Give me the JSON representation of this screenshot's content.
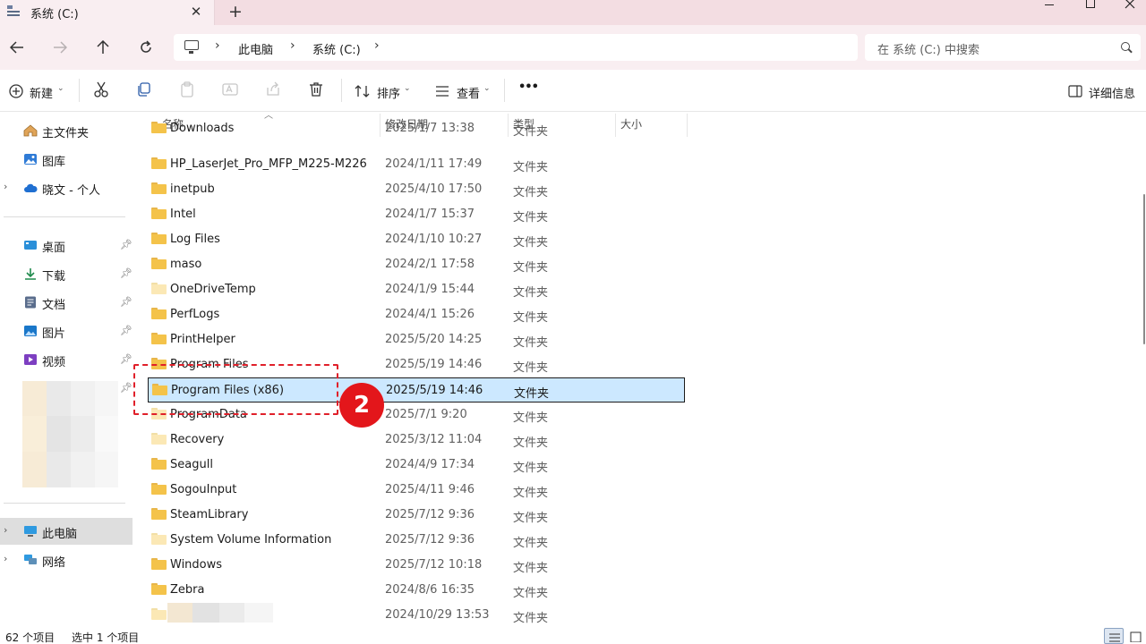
{
  "window": {
    "tab_title": "系统 (C:)",
    "tab_close_glyph": "✕",
    "new_tab_glyph": "+"
  },
  "nav": {
    "breadcrumb": [
      "此电脑",
      "系统 (C:)"
    ],
    "search_placeholder": "在 系统 (C:) 中搜索"
  },
  "toolbar": {
    "new_label": "新建",
    "sort_label": "排序",
    "view_label": "查看",
    "more_label": "•••",
    "details_label": "详细信息"
  },
  "sidebar": {
    "home": "主文件夹",
    "gallery": "图库",
    "onedrive": "晓文 - 个人",
    "desktop": "桌面",
    "downloads": "下载",
    "documents": "文档",
    "pictures": "图片",
    "videos": "视频",
    "this_pc": "此电脑",
    "network": "网络"
  },
  "columns": {
    "name": "名称",
    "modified": "修改日期",
    "type": "类型",
    "size": "大小"
  },
  "files": [
    {
      "name": "Downloads",
      "date": "2025/1/7 13:38",
      "type": "文件夹",
      "light": false
    },
    {
      "name": "HP_LaserJet_Pro_MFP_M225-M226",
      "date": "2024/1/11 17:49",
      "type": "文件夹",
      "light": false
    },
    {
      "name": "inetpub",
      "date": "2025/4/10 17:50",
      "type": "文件夹",
      "light": false
    },
    {
      "name": "Intel",
      "date": "2024/1/7 15:37",
      "type": "文件夹",
      "light": false
    },
    {
      "name": "Log Files",
      "date": "2024/1/10 10:27",
      "type": "文件夹",
      "light": false
    },
    {
      "name": "maso",
      "date": "2024/2/1 17:58",
      "type": "文件夹",
      "light": false
    },
    {
      "name": "OneDriveTemp",
      "date": "2024/1/9 15:44",
      "type": "文件夹",
      "light": true
    },
    {
      "name": "PerfLogs",
      "date": "2024/4/1 15:26",
      "type": "文件夹",
      "light": false
    },
    {
      "name": "PrintHelper",
      "date": "2025/5/20 14:25",
      "type": "文件夹",
      "light": false
    },
    {
      "name": "Program Files",
      "date": "2025/5/19 14:46",
      "type": "文件夹",
      "light": false
    },
    {
      "name": "Program Files (x86)",
      "date": "2025/5/19 14:46",
      "type": "文件夹",
      "light": false,
      "selected": true
    },
    {
      "name": "ProgramData",
      "date": "2025/7/1 9:20",
      "type": "文件夹",
      "light": true
    },
    {
      "name": "Recovery",
      "date": "2025/3/12 11:04",
      "type": "文件夹",
      "light": true
    },
    {
      "name": "Seagull",
      "date": "2024/4/9 17:34",
      "type": "文件夹",
      "light": false
    },
    {
      "name": "SogouInput",
      "date": "2025/4/11 9:46",
      "type": "文件夹",
      "light": false
    },
    {
      "name": "SteamLibrary",
      "date": "2025/7/12 9:36",
      "type": "文件夹",
      "light": false
    },
    {
      "name": "System Volume Information",
      "date": "2025/7/12 9:36",
      "type": "文件夹",
      "light": true
    },
    {
      "name": "Windows",
      "date": "2025/7/12 10:18",
      "type": "文件夹",
      "light": false
    },
    {
      "name": "Zebra",
      "date": "2024/8/6 16:35",
      "type": "文件夹",
      "light": false
    },
    {
      "name": "",
      "date": "2024/10/29 13:53",
      "type": "文件夹",
      "light": true,
      "redacted": true
    }
  ],
  "annotation": {
    "step_number": "2",
    "color": "#e3161b"
  },
  "status": {
    "item_count": "62 个项目",
    "selected_count": "选中 1 个项目"
  },
  "colors": {
    "titlebar": "#f3dde2",
    "navbar": "#f9eef1",
    "selection": "#cce8ff",
    "folder": "#f4c34a"
  }
}
